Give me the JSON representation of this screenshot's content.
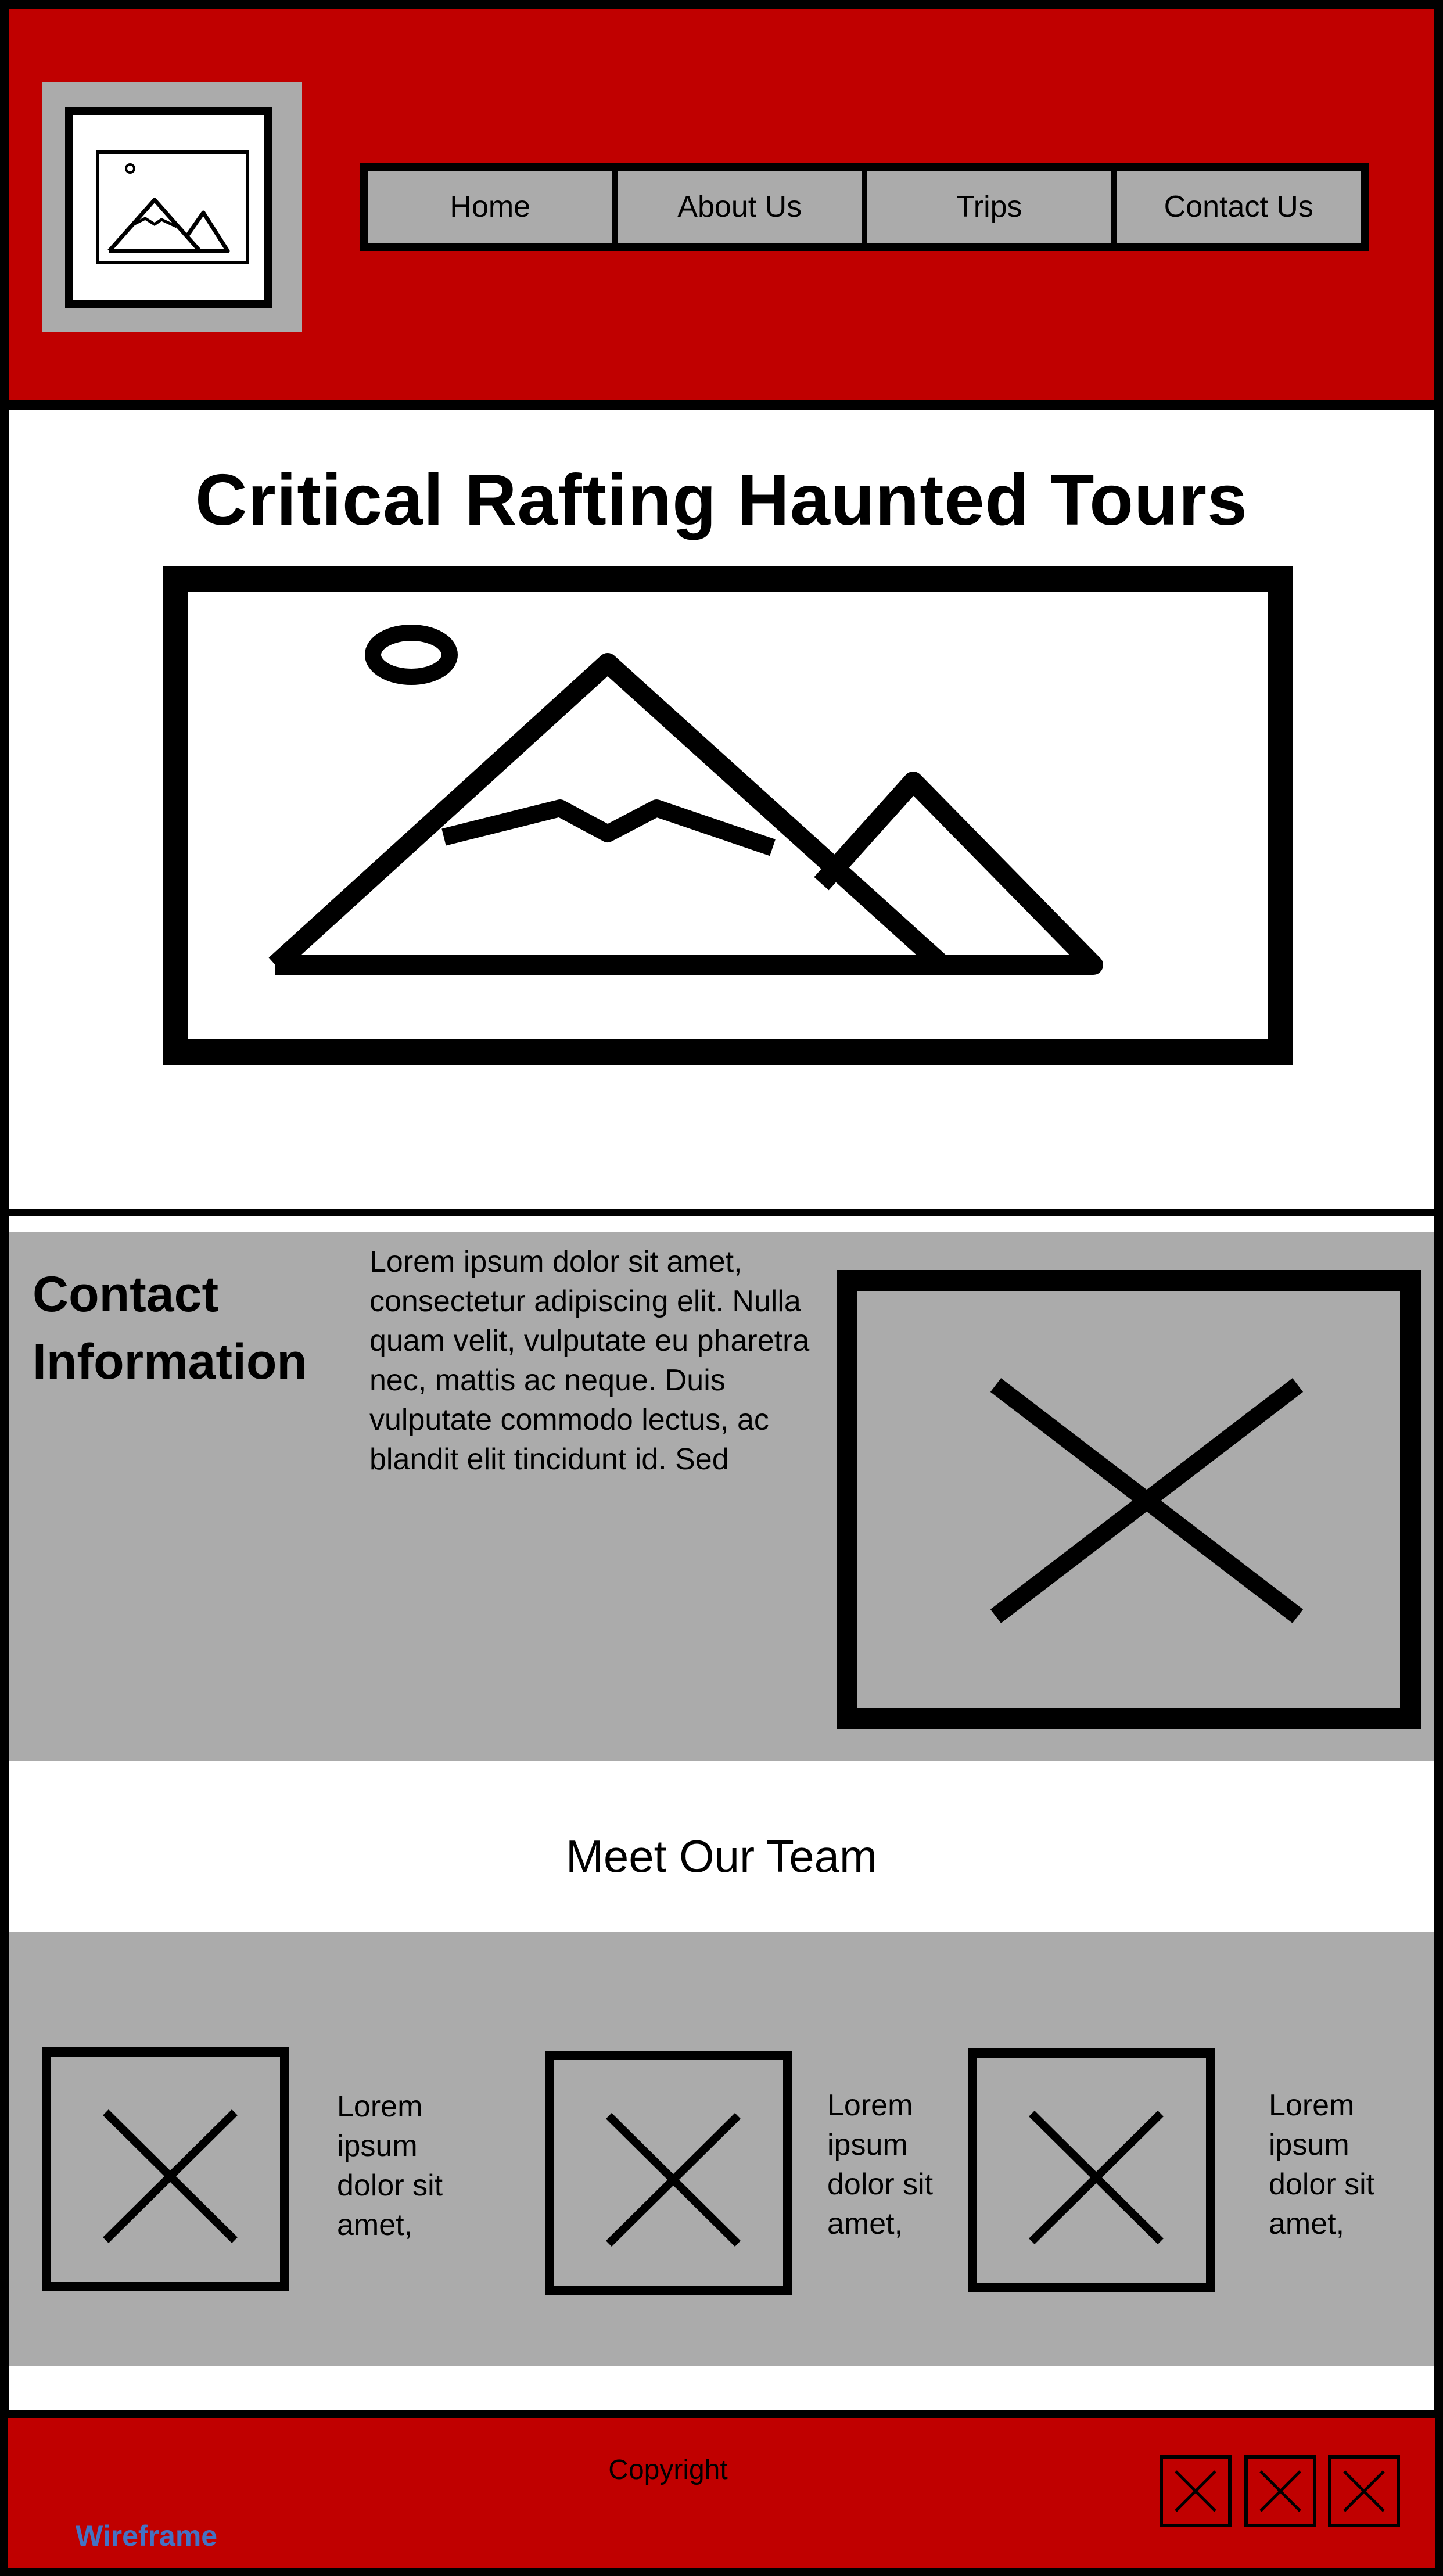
{
  "header": {
    "logo_icon": "image-placeholder-icon",
    "nav": [
      "Home",
      "About Us",
      "Trips",
      "Contact Us"
    ]
  },
  "hero": {
    "title": "Critical Rafting Haunted Tours",
    "image_icon": "mountain-image-icon"
  },
  "contact": {
    "title_line1": "Contact",
    "title_line2": "Information",
    "body": "Lorem ipsum dolor sit amet, consectetur adipiscing elit. Nulla quam velit, vulputate eu pharetra nec, mattis ac neque. Duis vulputate commodo lectus, ac blandit elit tincidunt id. Sed",
    "image_icon": "image-placeholder-x-icon"
  },
  "team": {
    "title": "Meet Our Team",
    "members": [
      {
        "text": "Lorem ipsum dolor sit amet,"
      },
      {
        "text": "Lorem ipsum dolor sit amet,"
      },
      {
        "text": "Lorem ipsum dolor sit amet,"
      }
    ]
  },
  "footer": {
    "copyright": "Copyright",
    "wireframe_label": "Wireframe",
    "social_icons": [
      "social-icon-1",
      "social-icon-2",
      "social-icon-3"
    ]
  },
  "colors": {
    "brand_red": "#c00000",
    "placeholder_gray": "#ababab",
    "wireframe_blue": "#4472c4"
  }
}
